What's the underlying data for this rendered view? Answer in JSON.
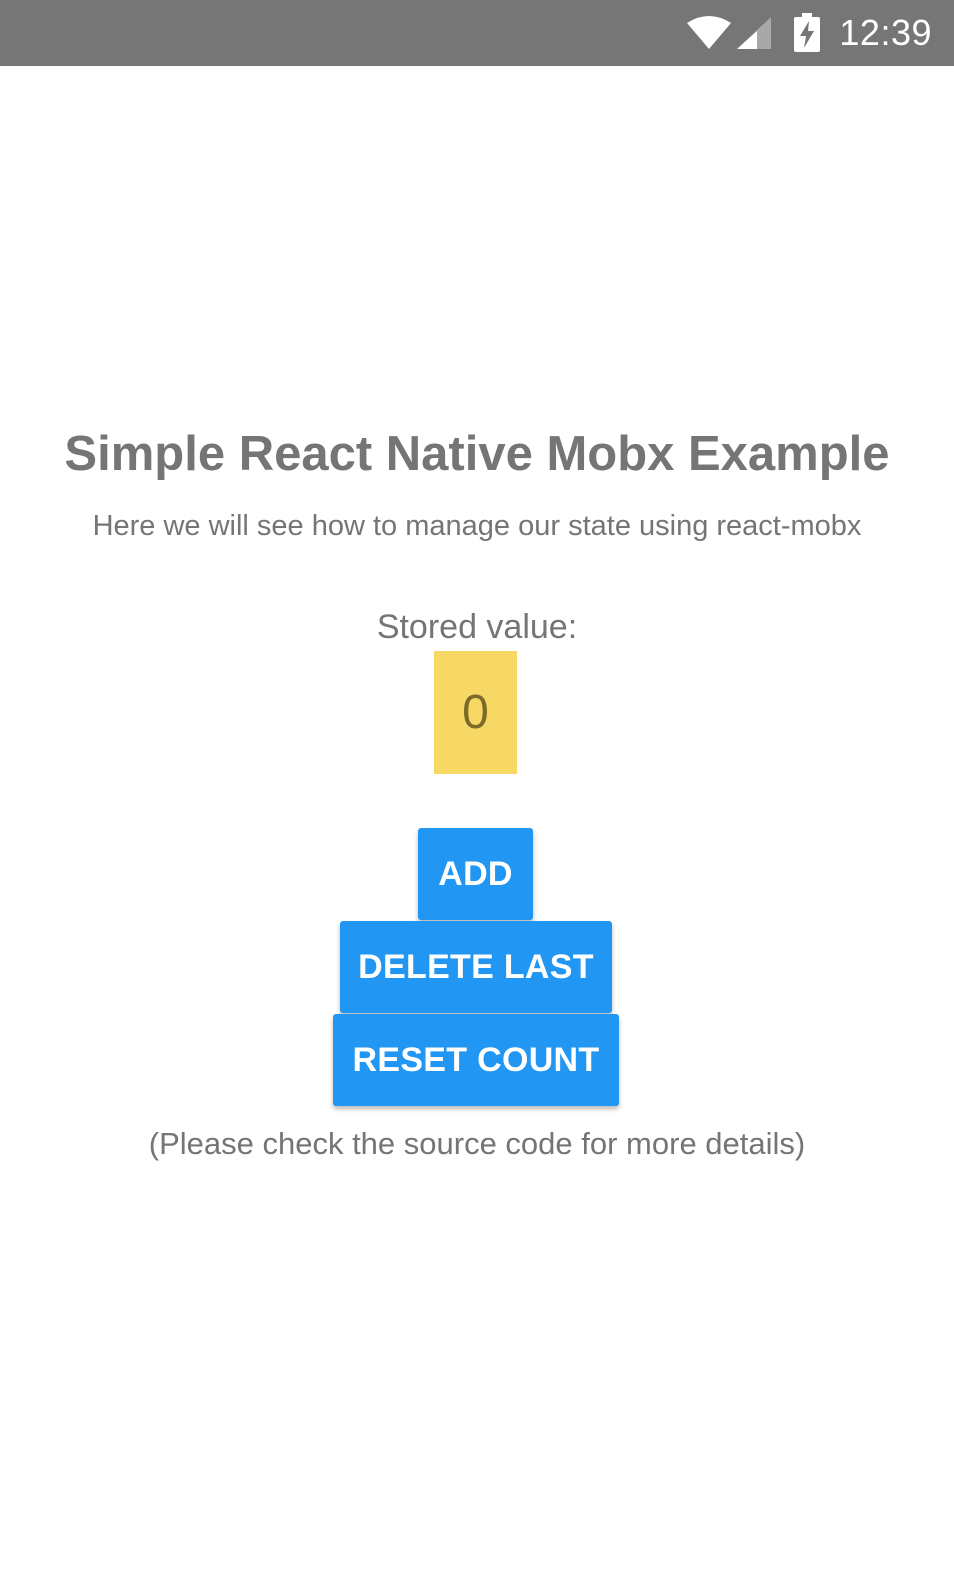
{
  "status_bar": {
    "time": "12:39",
    "icons": [
      "wifi-icon",
      "signal-icon",
      "battery-charging-icon"
    ],
    "background": "#767676"
  },
  "screen": {
    "title": "Simple React Native Mobx Example",
    "subtitle": "Here we will see how to manage our state using react-mobx",
    "stored_label": "Stored value:",
    "stored_value": "0",
    "value_box_color": "#f8d865",
    "buttons": {
      "add": "ADD",
      "delete_last": "DELETE LAST",
      "reset_count": "RESET COUNT"
    },
    "button_color": "#2196f3",
    "footer_note": "(Please check the source code for more details)"
  }
}
